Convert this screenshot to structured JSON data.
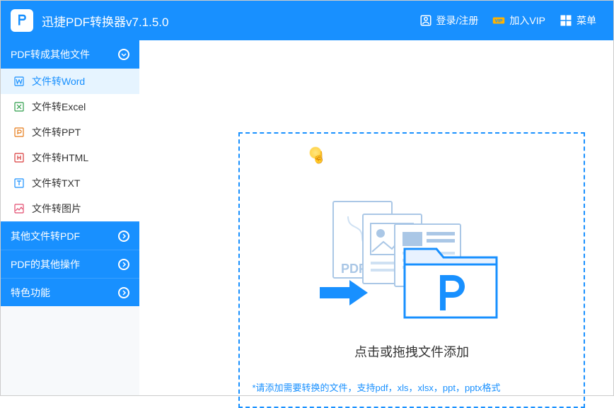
{
  "titlebar": {
    "app_title": "迅捷PDF转换器v7.1.5.0",
    "login_label": "登录/注册",
    "vip_label": "加入VIP",
    "menu_label": "菜单"
  },
  "sidebar": {
    "groups": [
      {
        "label": "PDF转成其他文件",
        "expanded": true,
        "items": [
          {
            "label": "文件转Word",
            "icon": "word",
            "color": "#1890ff",
            "active": true
          },
          {
            "label": "文件转Excel",
            "icon": "excel",
            "color": "#2e9e4a"
          },
          {
            "label": "文件转PPT",
            "icon": "ppt",
            "color": "#e67a17"
          },
          {
            "label": "文件转HTML",
            "icon": "html",
            "color": "#d93c3c"
          },
          {
            "label": "文件转TXT",
            "icon": "txt",
            "color": "#1890ff"
          },
          {
            "label": "文件转图片",
            "icon": "img",
            "color": "#e24b6e"
          }
        ]
      },
      {
        "label": "其他文件转PDF",
        "expanded": false
      },
      {
        "label": "PDF的其他操作",
        "expanded": false
      },
      {
        "label": "特色功能",
        "expanded": false
      }
    ]
  },
  "main": {
    "drop_text": "点击或拖拽文件添加",
    "hint_text": "*请添加需要转换的文件，支持pdf，xls，xlsx，ppt，pptx格式"
  },
  "colors": {
    "primary": "#1890ff",
    "text": "#333333"
  }
}
